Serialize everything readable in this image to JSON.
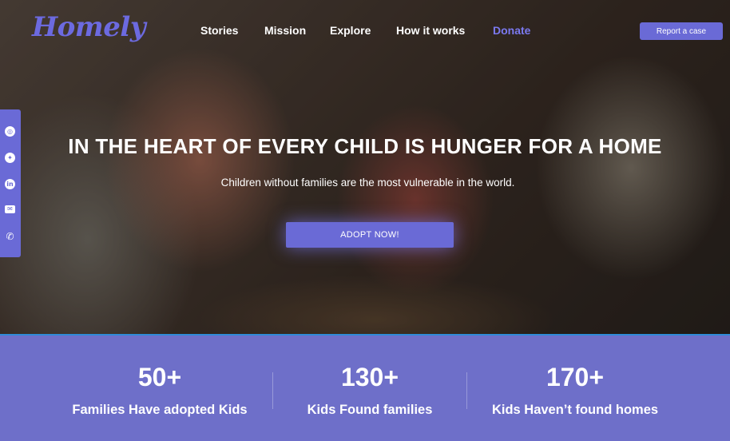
{
  "brand": {
    "logo": "Homely"
  },
  "nav": {
    "items": [
      {
        "label": "Stories"
      },
      {
        "label": "Mission"
      },
      {
        "label": "Explore"
      },
      {
        "label": "How it works"
      },
      {
        "label": "Donate"
      }
    ],
    "active": "Donate",
    "report_button": "Report  a case"
  },
  "social": {
    "icons": [
      "instagram-icon",
      "twitter-icon",
      "linkedin-icon",
      "mail-icon",
      "phone-icon"
    ]
  },
  "hero": {
    "headline": "IN THE HEART OF EVERY CHILD IS HUNGER FOR A HOME",
    "subline": "Children without families are the most vulnerable in the world.",
    "cta": "ADOPT NOW!"
  },
  "stats": [
    {
      "value": "50+",
      "label": "Families Have adopted Kids"
    },
    {
      "value": "130+",
      "label": "Kids Found families"
    },
    {
      "value": "170+",
      "label": "Kids Haven’t found homes"
    }
  ],
  "colors": {
    "accent": "#6a6ad6",
    "stats_bg": "#6e6fc9",
    "active_nav": "#7b79f0"
  }
}
